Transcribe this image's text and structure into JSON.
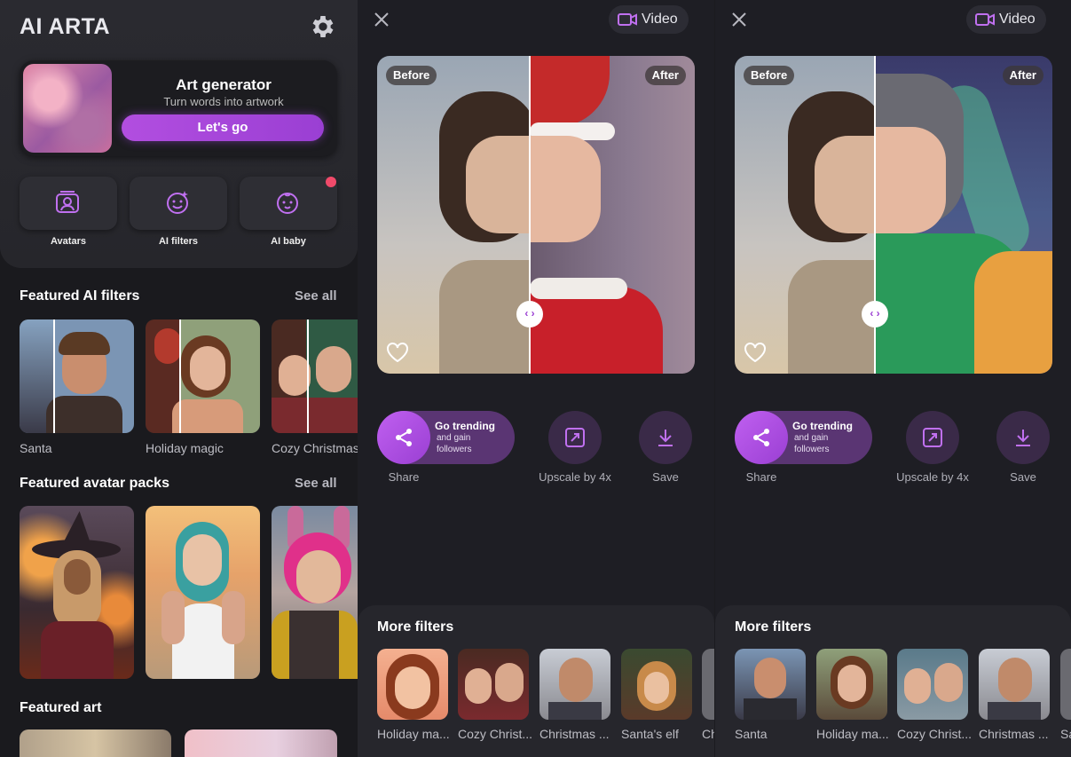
{
  "home": {
    "app_title": "AI ARTA",
    "art_card": {
      "title": "Art generator",
      "subtitle": "Turn words into artwork",
      "button": "Let's go"
    },
    "tiles": [
      {
        "label": "Avatars"
      },
      {
        "label": "AI filters"
      },
      {
        "label": "AI baby"
      }
    ],
    "featured_filters": {
      "title": "Featured AI filters",
      "see_all": "See all",
      "items": [
        "Santa",
        "Holiday magic",
        "Cozy Christmas"
      ]
    },
    "featured_avatars": {
      "title": "Featured avatar packs",
      "see_all": "See all"
    },
    "featured_art": {
      "title": "Featured art"
    }
  },
  "editor_a": {
    "video_label": "Video",
    "before": "Before",
    "after": "After",
    "share": {
      "title": "Go trending",
      "sub": "and gain followers",
      "label": "Share"
    },
    "upscale_label": "Upscale by 4x",
    "save_label": "Save",
    "more_title": "More filters",
    "more_items": [
      "Holiday ma...",
      "Cozy Christ...",
      "Christmas ...",
      "Santa's elf",
      "Ch"
    ]
  },
  "editor_b": {
    "video_label": "Video",
    "before": "Before",
    "after": "After",
    "share": {
      "title": "Go trending",
      "sub": "and gain followers",
      "label": "Share"
    },
    "upscale_label": "Upscale by 4x",
    "save_label": "Save",
    "more_title": "More filters",
    "more_items": [
      "Santa",
      "Holiday ma...",
      "Cozy Christ...",
      "Christmas ...",
      "Sa"
    ]
  },
  "colors": {
    "accent": "#9a3fd3",
    "background": "#1e1e24",
    "notification": "#f04a6a"
  }
}
